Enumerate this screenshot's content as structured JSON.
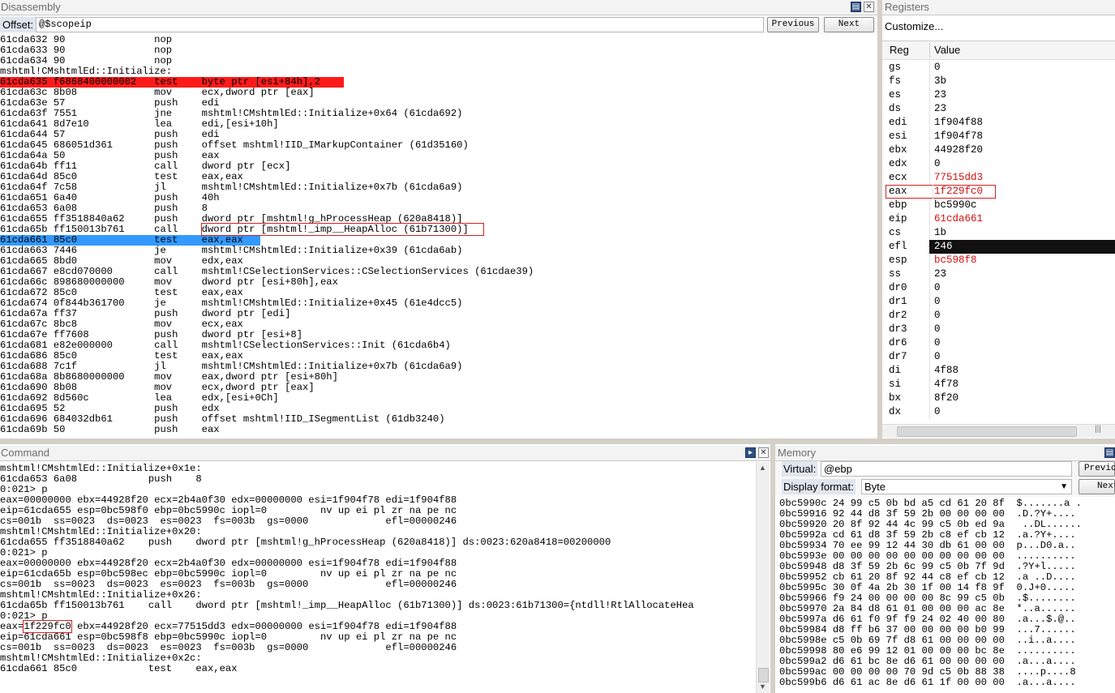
{
  "disassembly": {
    "title": "Disassembly",
    "offset_label": "Offset:",
    "offset_value": "@$scopeip",
    "previous_label": "Previous",
    "next_label": "Next",
    "lines": [
      {
        "addr": "61cda632",
        "bytes": "90",
        "mn": "nop",
        "ops": "",
        "hl": ""
      },
      {
        "addr": "61cda633",
        "bytes": "90",
        "mn": "nop",
        "ops": "",
        "hl": ""
      },
      {
        "addr": "61cda634",
        "bytes": "90",
        "mn": "nop",
        "ops": "",
        "hl": ""
      },
      {
        "label": "mshtml!CMshtmlEd::Initialize:"
      },
      {
        "addr": "61cda635",
        "bytes": "f6868400000002",
        "mn": "test",
        "ops": "byte ptr [esi+84h],2",
        "hl": "red"
      },
      {
        "addr": "61cda63c",
        "bytes": "8b08",
        "mn": "mov",
        "ops": "ecx,dword ptr [eax]",
        "hl": ""
      },
      {
        "addr": "61cda63e",
        "bytes": "57",
        "mn": "push",
        "ops": "edi",
        "hl": ""
      },
      {
        "addr": "61cda63f",
        "bytes": "7551",
        "mn": "jne",
        "ops": "mshtml!CMshtmlEd::Initialize+0x64 (61cda692)",
        "hl": ""
      },
      {
        "addr": "61cda641",
        "bytes": "8d7e10",
        "mn": "lea",
        "ops": "edi,[esi+10h]",
        "hl": ""
      },
      {
        "addr": "61cda644",
        "bytes": "57",
        "mn": "push",
        "ops": "edi",
        "hl": ""
      },
      {
        "addr": "61cda645",
        "bytes": "686051d361",
        "mn": "push",
        "ops": "offset mshtml!IID_IMarkupContainer (61d35160)",
        "hl": ""
      },
      {
        "addr": "61cda64a",
        "bytes": "50",
        "mn": "push",
        "ops": "eax",
        "hl": ""
      },
      {
        "addr": "61cda64b",
        "bytes": "ff11",
        "mn": "call",
        "ops": "dword ptr [ecx]",
        "hl": ""
      },
      {
        "addr": "61cda64d",
        "bytes": "85c0",
        "mn": "test",
        "ops": "eax,eax",
        "hl": ""
      },
      {
        "addr": "61cda64f",
        "bytes": "7c58",
        "mn": "jl",
        "ops": "mshtml!CMshtmlEd::Initialize+0x7b (61cda6a9)",
        "hl": ""
      },
      {
        "addr": "61cda651",
        "bytes": "6a40",
        "mn": "push",
        "ops": "40h",
        "hl": ""
      },
      {
        "addr": "61cda653",
        "bytes": "6a08",
        "mn": "push",
        "ops": "8",
        "hl": ""
      },
      {
        "addr": "61cda655",
        "bytes": "ff3518840a62",
        "mn": "push",
        "ops": "dword ptr [mshtml!g_hProcessHeap (620a8418)]",
        "hl": ""
      },
      {
        "addr": "61cda65b",
        "bytes": "ff150013b761",
        "mn": "call",
        "ops": "dword ptr [mshtml!_imp__HeapAlloc (61b71300)]",
        "hl": "box"
      },
      {
        "addr": "61cda661",
        "bytes": "85c0",
        "mn": "test",
        "ops": "eax,eax",
        "hl": "blue"
      },
      {
        "addr": "61cda663",
        "bytes": "7446",
        "mn": "je",
        "ops": "mshtml!CMshtmlEd::Initialize+0x39 (61cda6ab)",
        "hl": ""
      },
      {
        "addr": "61cda665",
        "bytes": "8bd0",
        "mn": "mov",
        "ops": "edx,eax",
        "hl": ""
      },
      {
        "addr": "61cda667",
        "bytes": "e8cd070000",
        "mn": "call",
        "ops": "mshtml!CSelectionServices::CSelectionServices (61cdae39)",
        "hl": ""
      },
      {
        "addr": "61cda66c",
        "bytes": "898680000000",
        "mn": "mov",
        "ops": "dword ptr [esi+80h],eax",
        "hl": ""
      },
      {
        "addr": "61cda672",
        "bytes": "85c0",
        "mn": "test",
        "ops": "eax,eax",
        "hl": ""
      },
      {
        "addr": "61cda674",
        "bytes": "0f844b361700",
        "mn": "je",
        "ops": "mshtml!CMshtmlEd::Initialize+0x45 (61e4dcc5)",
        "hl": ""
      },
      {
        "addr": "61cda67a",
        "bytes": "ff37",
        "mn": "push",
        "ops": "dword ptr [edi]",
        "hl": ""
      },
      {
        "addr": "61cda67c",
        "bytes": "8bc8",
        "mn": "mov",
        "ops": "ecx,eax",
        "hl": ""
      },
      {
        "addr": "61cda67e",
        "bytes": "ff7608",
        "mn": "push",
        "ops": "dword ptr [esi+8]",
        "hl": ""
      },
      {
        "addr": "61cda681",
        "bytes": "e82e000000",
        "mn": "call",
        "ops": "mshtml!CSelectionServices::Init (61cda6b4)",
        "hl": ""
      },
      {
        "addr": "61cda686",
        "bytes": "85c0",
        "mn": "test",
        "ops": "eax,eax",
        "hl": ""
      },
      {
        "addr": "61cda688",
        "bytes": "7c1f",
        "mn": "jl",
        "ops": "mshtml!CMshtmlEd::Initialize+0x7b (61cda6a9)",
        "hl": ""
      },
      {
        "addr": "61cda68a",
        "bytes": "8b8680000000",
        "mn": "mov",
        "ops": "eax,dword ptr [esi+80h]",
        "hl": ""
      },
      {
        "addr": "61cda690",
        "bytes": "8b08",
        "mn": "mov",
        "ops": "ecx,dword ptr [eax]",
        "hl": ""
      },
      {
        "addr": "61cda692",
        "bytes": "8d560c",
        "mn": "lea",
        "ops": "edx,[esi+0Ch]",
        "hl": ""
      },
      {
        "addr": "61cda695",
        "bytes": "52",
        "mn": "push",
        "ops": "edx",
        "hl": ""
      },
      {
        "addr": "61cda696",
        "bytes": "684032db61",
        "mn": "push",
        "ops": "offset mshtml!IID_ISegmentList (61db3240)",
        "hl": ""
      },
      {
        "addr": "61cda69b",
        "bytes": "50",
        "mn": "push",
        "ops": "eax",
        "hl": ""
      }
    ]
  },
  "registers": {
    "title": "Registers",
    "customize_label": "Customize...",
    "col_reg": "Reg",
    "col_value": "Value",
    "rows": [
      {
        "reg": "gs",
        "val": "0",
        "style": ""
      },
      {
        "reg": "fs",
        "val": "3b",
        "style": ""
      },
      {
        "reg": "es",
        "val": "23",
        "style": ""
      },
      {
        "reg": "ds",
        "val": "23",
        "style": ""
      },
      {
        "reg": "edi",
        "val": "1f904f88",
        "style": ""
      },
      {
        "reg": "esi",
        "val": "1f904f78",
        "style": ""
      },
      {
        "reg": "ebx",
        "val": "44928f20",
        "style": ""
      },
      {
        "reg": "edx",
        "val": "0",
        "style": ""
      },
      {
        "reg": "ecx",
        "val": "77515dd3",
        "style": "red"
      },
      {
        "reg": "eax",
        "val": "1f229fc0",
        "style": "redbox"
      },
      {
        "reg": "ebp",
        "val": "bc5990c",
        "style": ""
      },
      {
        "reg": "eip",
        "val": "61cda661",
        "style": "red"
      },
      {
        "reg": "cs",
        "val": "1b",
        "style": ""
      },
      {
        "reg": "efl",
        "val": "246",
        "style": "selected"
      },
      {
        "reg": "esp",
        "val": "bc598f8",
        "style": "red"
      },
      {
        "reg": "ss",
        "val": "23",
        "style": ""
      },
      {
        "reg": "dr0",
        "val": "0",
        "style": ""
      },
      {
        "reg": "dr1",
        "val": "0",
        "style": ""
      },
      {
        "reg": "dr2",
        "val": "0",
        "style": ""
      },
      {
        "reg": "dr3",
        "val": "0",
        "style": ""
      },
      {
        "reg": "dr6",
        "val": "0",
        "style": ""
      },
      {
        "reg": "dr7",
        "val": "0",
        "style": ""
      },
      {
        "reg": "di",
        "val": "4f88",
        "style": ""
      },
      {
        "reg": "si",
        "val": "4f78",
        "style": ""
      },
      {
        "reg": "bx",
        "val": "8f20",
        "style": ""
      },
      {
        "reg": "dx",
        "val": "0",
        "style": ""
      }
    ]
  },
  "command": {
    "title": "Command",
    "lines": [
      "mshtml!CMshtmlEd::Initialize+0x1e:",
      "61cda653 6a08            push    8",
      "0:021> p",
      "eax=00000000 ebx=44928f20 ecx=2b4a0f30 edx=00000000 esi=1f904f78 edi=1f904f88",
      "eip=61cda655 esp=0bc598f0 ebp=0bc5990c iopl=0         nv up ei pl zr na pe nc",
      "cs=001b  ss=0023  ds=0023  es=0023  fs=003b  gs=0000             efl=00000246",
      "mshtml!CMshtmlEd::Initialize+0x20:",
      "61cda655 ff3518840a62    push    dword ptr [mshtml!g_hProcessHeap (620a8418)] ds:0023:620a8418=00200000",
      "0:021> p",
      "eax=00000000 ebx=44928f20 ecx=2b4a0f30 edx=00000000 esi=1f904f78 edi=1f904f88",
      "eip=61cda65b esp=0bc598ec ebp=0bc5990c iopl=0         nv up ei pl zr na pe nc",
      "cs=001b  ss=0023  ds=0023  es=0023  fs=003b  gs=0000             efl=00000246",
      "mshtml!CMshtmlEd::Initialize+0x26:",
      "61cda65b ff150013b761    call    dword ptr [mshtml!_imp__HeapAlloc (61b71300)] ds:0023:61b71300={ntdll!RtlAllocateHea",
      "0:021> p",
      "eax=1f229fc0 ebx=44928f20 ecx=77515dd3 edx=00000000 esi=1f904f78 edi=1f904f88",
      "eip=61cda661 esp=0bc598f8 ebp=0bc5990c iopl=0         nv up ei pl zr na pe nc",
      "cs=001b  ss=0023  ds=0023  es=0023  fs=003b  gs=0000             efl=00000246",
      "mshtml!CMshtmlEd::Initialize+0x2c:",
      "61cda661 85c0            test    eax,eax"
    ],
    "eax_prefix": "eax=",
    "eax_boxed": "1f229fc0",
    "eax_rest": " ebx=44928f20 ecx=77515dd3 edx=00000000 esi=1f904f78 edi=1f904f88"
  },
  "memory": {
    "title": "Memory",
    "virtual_label": "Virtual:",
    "virtual_value": "@ebp",
    "display_label": "Display format:",
    "display_value": "Byte",
    "previous_label": "Previo",
    "next_label": "Next",
    "rows": [
      "0bc5990c 24 99 c5 0b bd a5 cd 61 20 8f  $.......a .",
      "0bc59916 92 44 d8 3f 59 2b 00 00 00 00  .D.?Y+....",
      "0bc59920 20 8f 92 44 4c 99 c5 0b ed 9a   ..DL......",
      "0bc5992a cd 61 d8 3f 59 2b c8 ef cb 12  .a.?Y+....",
      "0bc59934 70 ee 99 12 44 30 db 61 00 00  p...D0.a..",
      "0bc5993e 00 00 00 00 00 00 00 00 00 00  ..........",
      "0bc59948 d8 3f 59 2b 6c 99 c5 0b 7f 9d  .?Y+l.....",
      "0bc59952 cb 61 20 8f 92 44 c8 ef cb 12  .a ..D....",
      "0bc5995c 30 0f 4a 2b 30 1f 00 14 f8 9f  0.J+0.....",
      "0bc59966 f9 24 00 00 00 00 8c 99 c5 0b  .$........",
      "0bc59970 2a 84 d8 61 01 00 00 00 ac 8e  *..a......",
      "0bc5997a d6 61 f0 9f f9 24 02 40 00 80  .a...$.@..",
      "0bc59984 d8 ff b6 37 00 00 00 00 b0 99  ...7......",
      "0bc5998e c5 0b 69 7f d8 61 00 00 00 00  ..i..a....",
      "0bc59998 80 e6 99 12 01 00 00 00 bc 8e  ..........",
      "0bc599a2 d6 61 bc 8e d6 61 00 00 00 00  .a...a....",
      "0bc599ac 00 00 00 00 70 9d c5 0b 88 38  ....p....8",
      "0bc599b6 d6 61 ac 8e d6 61 1f 00 00 00  .a...a...."
    ]
  }
}
